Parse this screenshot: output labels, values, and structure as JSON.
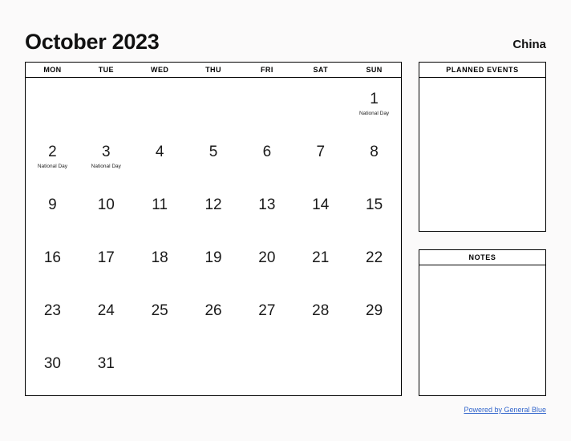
{
  "header": {
    "title": "October 2023",
    "region": "China"
  },
  "calendar": {
    "weekday_headers": [
      "MON",
      "TUE",
      "WED",
      "THU",
      "FRI",
      "SAT",
      "SUN"
    ],
    "weeks": [
      [
        {
          "day": "",
          "event": ""
        },
        {
          "day": "",
          "event": ""
        },
        {
          "day": "",
          "event": ""
        },
        {
          "day": "",
          "event": ""
        },
        {
          "day": "",
          "event": ""
        },
        {
          "day": "",
          "event": ""
        },
        {
          "day": "1",
          "event": "National Day"
        }
      ],
      [
        {
          "day": "2",
          "event": "National Day"
        },
        {
          "day": "3",
          "event": "National Day"
        },
        {
          "day": "4",
          "event": ""
        },
        {
          "day": "5",
          "event": ""
        },
        {
          "day": "6",
          "event": ""
        },
        {
          "day": "7",
          "event": ""
        },
        {
          "day": "8",
          "event": ""
        }
      ],
      [
        {
          "day": "9",
          "event": ""
        },
        {
          "day": "10",
          "event": ""
        },
        {
          "day": "11",
          "event": ""
        },
        {
          "day": "12",
          "event": ""
        },
        {
          "day": "13",
          "event": ""
        },
        {
          "day": "14",
          "event": ""
        },
        {
          "day": "15",
          "event": ""
        }
      ],
      [
        {
          "day": "16",
          "event": ""
        },
        {
          "day": "17",
          "event": ""
        },
        {
          "day": "18",
          "event": ""
        },
        {
          "day": "19",
          "event": ""
        },
        {
          "day": "20",
          "event": ""
        },
        {
          "day": "21",
          "event": ""
        },
        {
          "day": "22",
          "event": ""
        }
      ],
      [
        {
          "day": "23",
          "event": ""
        },
        {
          "day": "24",
          "event": ""
        },
        {
          "day": "25",
          "event": ""
        },
        {
          "day": "26",
          "event": ""
        },
        {
          "day": "27",
          "event": ""
        },
        {
          "day": "28",
          "event": ""
        },
        {
          "day": "29",
          "event": ""
        }
      ],
      [
        {
          "day": "30",
          "event": ""
        },
        {
          "day": "31",
          "event": ""
        },
        {
          "day": "",
          "event": ""
        },
        {
          "day": "",
          "event": ""
        },
        {
          "day": "",
          "event": ""
        },
        {
          "day": "",
          "event": ""
        },
        {
          "day": "",
          "event": ""
        }
      ]
    ]
  },
  "panels": {
    "planned_events": {
      "title": "PLANNED EVENTS",
      "content": ""
    },
    "notes": {
      "title": "NOTES",
      "content": ""
    }
  },
  "footer": {
    "credit_text": "Powered by General Blue",
    "link_color": "#3366cc"
  }
}
